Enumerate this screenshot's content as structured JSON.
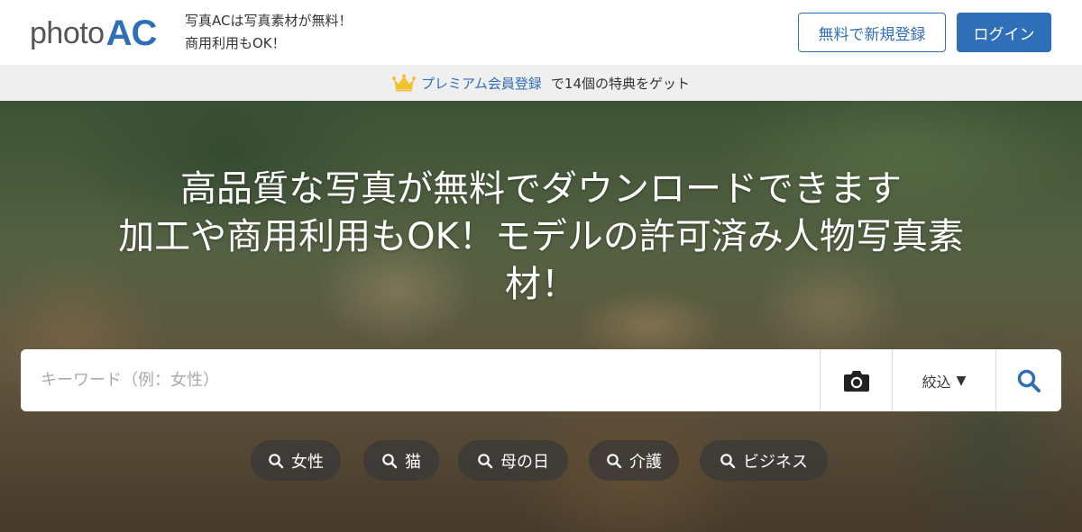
{
  "header": {
    "logo_photo": "photo",
    "logo_ac": "AC",
    "tagline_line1": "写真ACは写真素材が無料！",
    "tagline_line2": "商用利用もOK！",
    "register_label": "無料で新規登録",
    "login_label": "ログイン"
  },
  "premium": {
    "icon": "crown-icon",
    "link_label": "プレミアム会員登録",
    "text": "で14個の特典をゲット"
  },
  "hero": {
    "title_line1": "高品質な写真が無料でダウンロードできます",
    "title_line2": "加工や商用利用もOK！モデルの許可済み人物写真素",
    "title_line3": "材！"
  },
  "search": {
    "placeholder": "キーワード（例：女性）",
    "value": "",
    "filter_label": "絞込",
    "filter_arrow": "▼"
  },
  "tags": [
    {
      "label": "女性"
    },
    {
      "label": "猫"
    },
    {
      "label": "母の日"
    },
    {
      "label": "介護"
    },
    {
      "label": "ビジネス"
    }
  ],
  "colors": {
    "brand": "#2f6fb7",
    "crown": "#f2c230",
    "banner_bg": "#efefef"
  }
}
